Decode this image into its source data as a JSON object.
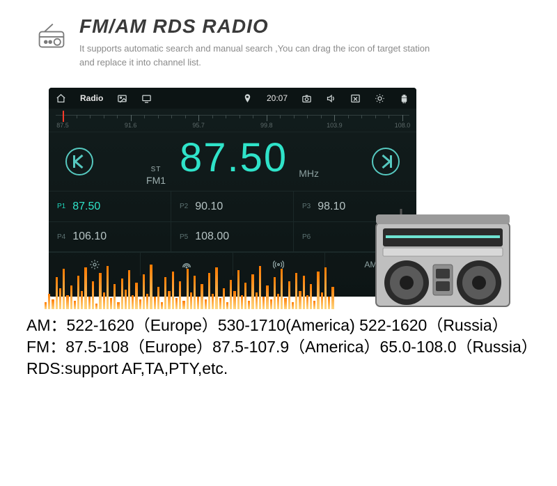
{
  "header": {
    "title": "FM/AM RDS RADIO",
    "blurb": "It supports automatic search and manual search ,You can drag the icon of target station and replace it into channel list."
  },
  "topbar": {
    "title": "Radio",
    "time": "20:07"
  },
  "dial": {
    "ticks": [
      "87.5",
      "91.6",
      "95.7",
      "99.8",
      "103.9",
      "108.0"
    ]
  },
  "main": {
    "st": "ST",
    "band": "FM1",
    "frequency": "87.50",
    "unit": "MHz"
  },
  "presets": [
    {
      "n": "P1",
      "v": "87.50",
      "active": true
    },
    {
      "n": "P2",
      "v": "90.10"
    },
    {
      "n": "P3",
      "v": "98.10"
    },
    {
      "n": "P4",
      "v": "106.10"
    },
    {
      "n": "P5",
      "v": "108.00"
    },
    {
      "n": "P6",
      "v": ""
    }
  ],
  "controls": {
    "amfm": "AM"
  },
  "spec": {
    "line1": "AM：522-1620（Europe）530-1710(America) 522-1620（Russia）",
    "line2": "FM：87.5-108（Europe）87.5-107.9（America）65.0-108.0（Russia）",
    "line3": "RDS:support AF,TA,PTY,etc."
  }
}
